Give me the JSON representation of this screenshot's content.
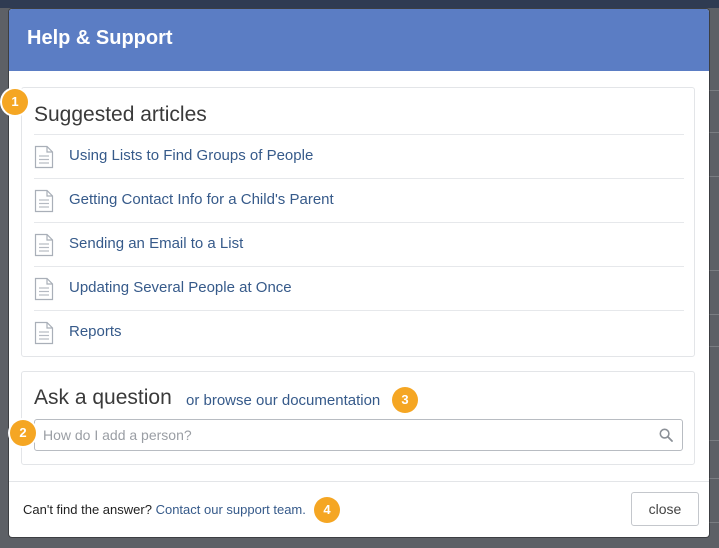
{
  "modal": {
    "title": "Help & Support"
  },
  "suggested": {
    "heading": "Suggested articles",
    "articles": [
      {
        "title": "Using Lists to Find Groups of People",
        "icon": "document-icon"
      },
      {
        "title": "Getting Contact Info for a Child's Parent",
        "icon": "document-icon"
      },
      {
        "title": "Sending an Email to a List",
        "icon": "document-icon"
      },
      {
        "title": "Updating Several People at Once",
        "icon": "document-icon"
      },
      {
        "title": "Reports",
        "icon": "document-icon"
      }
    ]
  },
  "ask": {
    "heading": "Ask a question",
    "browse_link": "or browse our documentation",
    "search_placeholder": "How do I add a person?",
    "search_icon": "search-icon"
  },
  "footer": {
    "prompt": "Can't find the answer?",
    "contact_link": "Contact our support team.",
    "close_label": "close"
  },
  "annotations": {
    "badge_1": "1",
    "badge_2": "2",
    "badge_3": "3",
    "badge_4": "4"
  },
  "colors": {
    "header_bg": "#5b7dc4",
    "link": "#365a8a",
    "badge": "#f5a623"
  }
}
